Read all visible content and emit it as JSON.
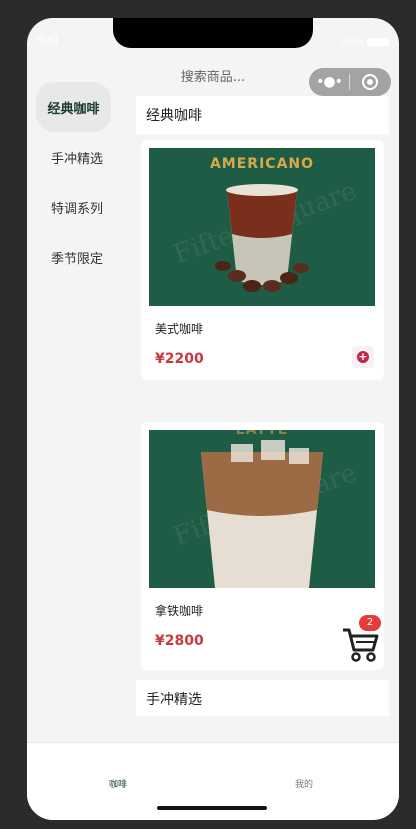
{
  "status_bar": {
    "time": "9:41",
    "signal": "100%"
  },
  "header": {
    "search_placeholder": "搜索商品..."
  },
  "sidebar": {
    "items": [
      {
        "label": "经典咖啡"
      },
      {
        "label": "手冲精选"
      },
      {
        "label": "特调系列"
      },
      {
        "label": "季节限定"
      }
    ]
  },
  "sections": [
    {
      "title": "经典咖啡"
    },
    {
      "title": "手冲精选"
    }
  ],
  "products": [
    {
      "name": "美式咖啡",
      "price": "¥2200",
      "image_title": "AMERICANO",
      "watermark": "Fifteen square"
    },
    {
      "name": "拿铁咖啡",
      "price": "¥2800",
      "image_title": "LATTE",
      "watermark": "Fifteen square"
    }
  ],
  "cart": {
    "count": "2"
  },
  "tabbar": {
    "items": [
      {
        "label": "咖啡"
      },
      {
        "label": "我的"
      }
    ]
  },
  "colors": {
    "accent": "#c83a3f",
    "image_bg": "#1f5c45",
    "active_tab": "#1a3a2c",
    "badge": "#e53b3b"
  }
}
